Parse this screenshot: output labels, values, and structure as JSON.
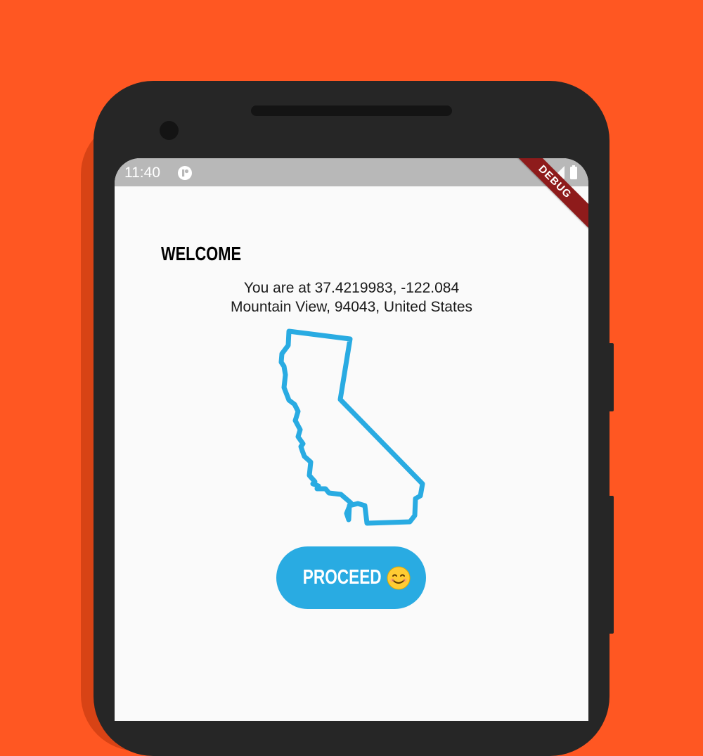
{
  "status_bar": {
    "time": "11:40",
    "icons": [
      "app-notification-icon",
      "wifi-icon",
      "signal-icon",
      "battery-icon"
    ],
    "background": "#B8B8B8"
  },
  "debug_banner": {
    "label": "DEBUG",
    "color": "#8E1B1B"
  },
  "screen": {
    "heading": "Welcome",
    "location_line1": "You are at 37.4219983, -122.084",
    "location_line2": "Mountain View, 94043, United States",
    "map_outline": {
      "region": "California",
      "stroke_color": "#29ABE2"
    },
    "proceed_button": {
      "label": "Proceed",
      "icon": "smiling-face-icon",
      "color": "#29ABE2"
    }
  },
  "colors": {
    "background": "#FF5722",
    "device": "#262626",
    "screen": "#FAFAFA",
    "accent": "#29ABE2"
  }
}
